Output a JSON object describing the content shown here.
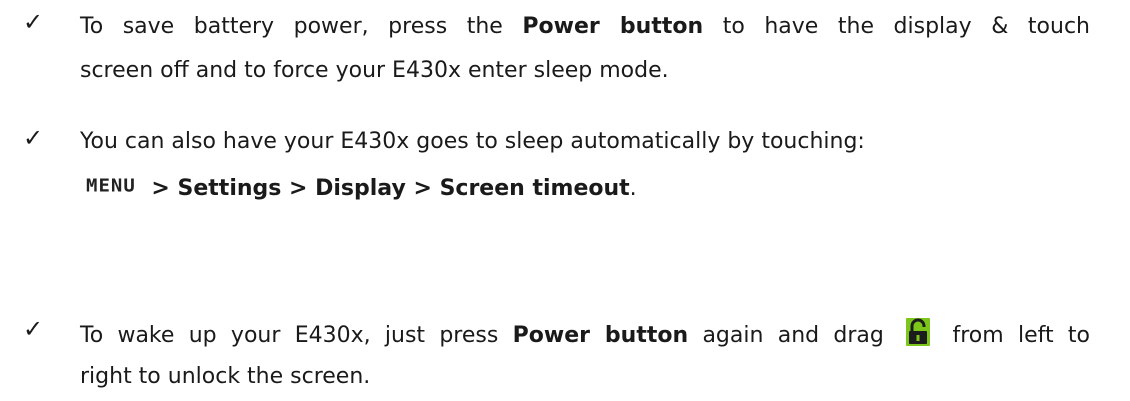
{
  "bullet1": {
    "icon": "checkmark-icon",
    "line1": {
      "part1": "To save battery power, press the ",
      "bold": "Power button",
      "part2": " to have the display & touch"
    },
    "line2": "screen off and to force your E430x enter sleep mode."
  },
  "bullet2": {
    "icon": "checkmark-icon",
    "line1": "You can also have your E430x goes to sleep automatically by touching:",
    "line2": {
      "menu_label": "MENU",
      "path": " > Settings > Display > Screen timeout",
      "end": "."
    }
  },
  "bullet3": {
    "icon": "checkmark-icon",
    "line1": {
      "part1": "To wake up your E430x, just press ",
      "bold": "Power button",
      "part2": " again and drag ",
      "icon": "unlock-icon",
      "part3": " from left to"
    },
    "line2": "right to unlock the screen."
  },
  "colors": {
    "text": "#1a1a1a",
    "lock_green": "#7cc61c",
    "lock_dark": "#1c1c1c"
  }
}
